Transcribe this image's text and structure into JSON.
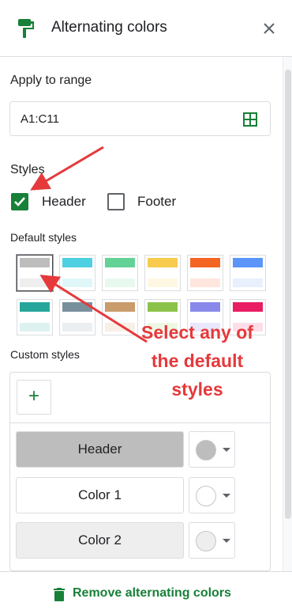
{
  "header": {
    "title": "Alternating colors",
    "icon": "paint-format-icon",
    "close_icon": "close-icon"
  },
  "range": {
    "label": "Apply to range",
    "value": "A1:C11",
    "icon": "grid-select-icon"
  },
  "styles": {
    "label": "Styles",
    "header_checkbox": {
      "label": "Header",
      "checked": true
    },
    "footer_checkbox": {
      "label": "Footer",
      "checked": false
    }
  },
  "default_styles": {
    "label": "Default styles",
    "swatches": [
      {
        "header": "#bdbdbd",
        "alt1": "#ffffff",
        "alt2": "#eeeeee",
        "selected": true
      },
      {
        "header": "#4dd0e1",
        "alt1": "#ffffff",
        "alt2": "#e0f7fa",
        "selected": false
      },
      {
        "header": "#63d297",
        "alt1": "#ffffff",
        "alt2": "#e7f9ef",
        "selected": false
      },
      {
        "header": "#f7cb4d",
        "alt1": "#ffffff",
        "alt2": "#fef8e3",
        "selected": false
      },
      {
        "header": "#f46524",
        "alt1": "#ffffff",
        "alt2": "#ffe6dd",
        "selected": false
      },
      {
        "header": "#5b95f9",
        "alt1": "#ffffff",
        "alt2": "#e8f0fe",
        "selected": false
      },
      {
        "header": "#26a69a",
        "alt1": "#ffffff",
        "alt2": "#ddf2f0",
        "selected": false
      },
      {
        "header": "#78909c",
        "alt1": "#ffffff",
        "alt2": "#ebeff1",
        "selected": false
      },
      {
        "header": "#ca9c6b",
        "alt1": "#ffffff",
        "alt2": "#f8efe6",
        "selected": false
      },
      {
        "header": "#8bc34a",
        "alt1": "#ffffff",
        "alt2": "#eef7e3",
        "selected": false
      },
      {
        "header": "#8989eb",
        "alt1": "#ffffff",
        "alt2": "#e8e7fc",
        "selected": false
      },
      {
        "header": "#e91d63",
        "alt1": "#ffffff",
        "alt2": "#fddde8",
        "selected": false
      }
    ]
  },
  "custom_styles": {
    "label": "Custom styles",
    "add_icon": "plus-icon",
    "add_symbol": "+",
    "rows": [
      {
        "label": "Header",
        "fill": "#bdbdbd",
        "dot": "#bdbdbd"
      },
      {
        "label": "Color 1",
        "fill": "#ffffff",
        "dot": "#ffffff"
      },
      {
        "label": "Color 2",
        "fill": "#eeeeee",
        "dot": "#eeeeee"
      }
    ]
  },
  "footer": {
    "remove_label": "Remove alternating colors",
    "icon": "trash-icon"
  },
  "annotation": {
    "text_line1": "Select any of",
    "text_line2": "the default",
    "text_line3": "styles",
    "color": "#e5393b"
  },
  "colors": {
    "accent_green": "#188038",
    "border": "#dadce0"
  }
}
